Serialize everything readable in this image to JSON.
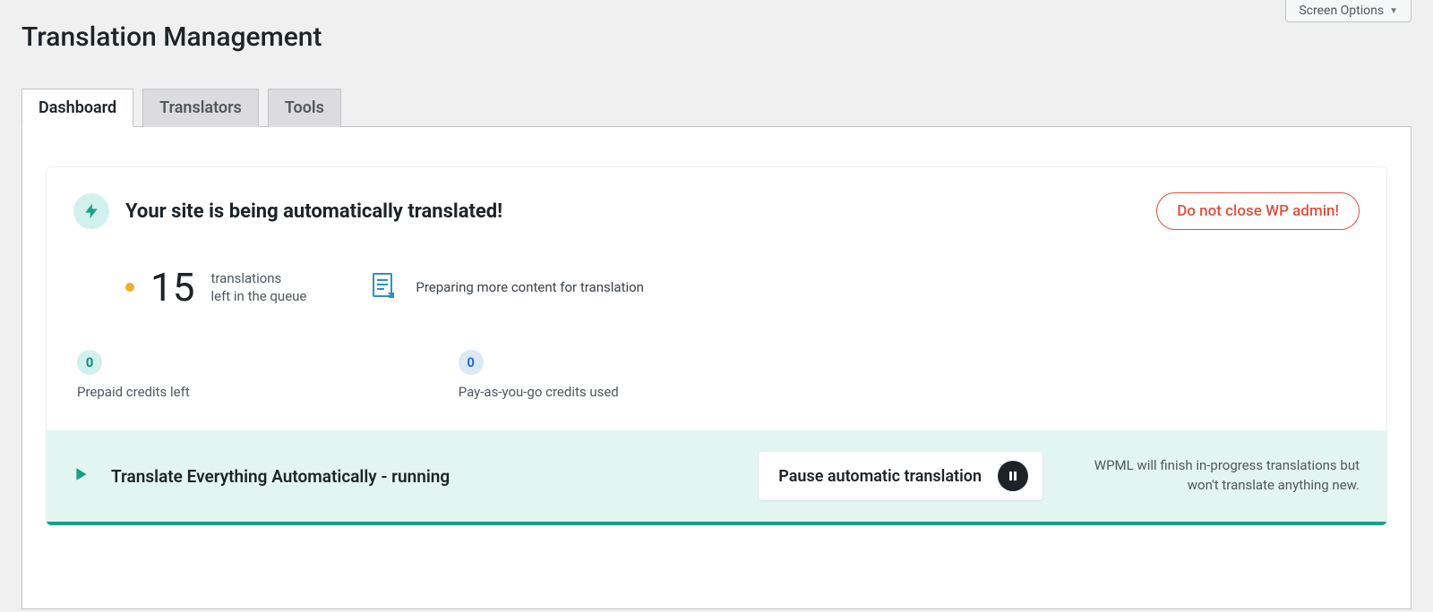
{
  "header": {
    "screen_options": "Screen Options",
    "title": "Translation Management"
  },
  "tabs": [
    {
      "label": "Dashboard",
      "active": true
    },
    {
      "label": "Translators",
      "active": false
    },
    {
      "label": "Tools",
      "active": false
    }
  ],
  "status_card": {
    "headline": "Your site is being automatically translated!",
    "warning": "Do not close WP admin!",
    "queue": {
      "count": "15",
      "line1": "translations",
      "line2": "left in the queue"
    },
    "preparing": "Preparing more content for translation",
    "credits": [
      {
        "value": "0",
        "label": "Prepaid credits left",
        "style": "teal"
      },
      {
        "value": "0",
        "label": "Pay-as-you-go credits used",
        "style": "blue"
      }
    ]
  },
  "running_bar": {
    "status": "Translate Everything Automatically - running",
    "pause_label": "Pause automatic translation",
    "note": "WPML will finish in-progress translations but won't translate anything new."
  },
  "colors": {
    "accent_teal": "#1aa085",
    "warning_red": "#e04f3d",
    "dot_amber": "#f0ad2e"
  }
}
